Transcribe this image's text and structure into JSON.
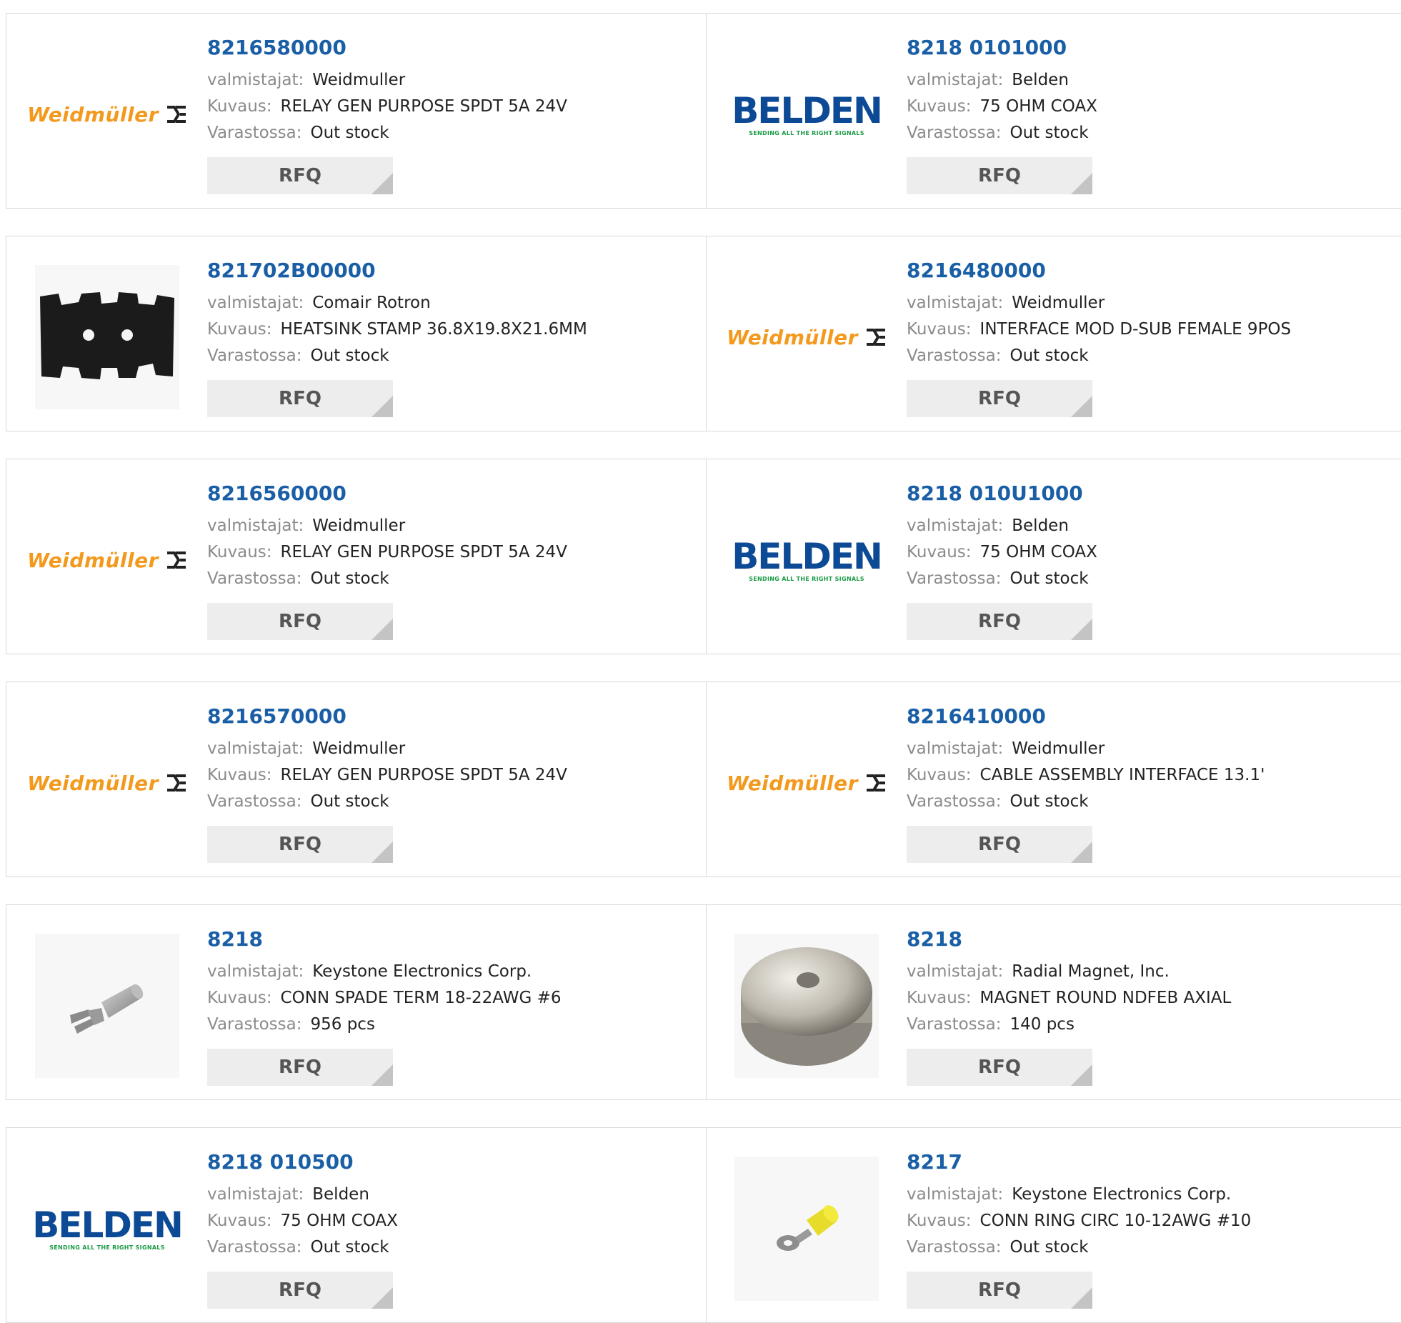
{
  "products": [
    {
      "part": "8216580000",
      "mfr_label": "valmistajat:",
      "mfr": "Weidmuller",
      "desc_label": "Kuvaus:",
      "desc": "RELAY GEN PURPOSE SPDT 5A 24V",
      "stock_label": "Varastossa:",
      "stock": "Out stock",
      "rfq": "RFQ",
      "thumb": "weidmuller-logo"
    },
    {
      "part": "8218 0101000",
      "mfr_label": "valmistajat:",
      "mfr": "Belden",
      "desc_label": "Kuvaus:",
      "desc": "75 OHM COAX",
      "stock_label": "Varastossa:",
      "stock": "Out stock",
      "rfq": "RFQ",
      "thumb": "belden-logo"
    },
    {
      "part": "821702B00000",
      "mfr_label": "valmistajat:",
      "mfr": "Comair Rotron",
      "desc_label": "Kuvaus:",
      "desc": "HEATSINK STAMP 36.8X19.8X21.6MM",
      "stock_label": "Varastossa:",
      "stock": "Out stock",
      "rfq": "RFQ",
      "thumb": "heatsink-photo"
    },
    {
      "part": "8216480000",
      "mfr_label": "valmistajat:",
      "mfr": "Weidmuller",
      "desc_label": "Kuvaus:",
      "desc": "INTERFACE MOD D-SUB FEMALE 9POS",
      "stock_label": "Varastossa:",
      "stock": "Out stock",
      "rfq": "RFQ",
      "thumb": "weidmuller-logo"
    },
    {
      "part": "8216560000",
      "mfr_label": "valmistajat:",
      "mfr": "Weidmuller",
      "desc_label": "Kuvaus:",
      "desc": "RELAY GEN PURPOSE SPDT 5A 24V",
      "stock_label": "Varastossa:",
      "stock": "Out stock",
      "rfq": "RFQ",
      "thumb": "weidmuller-logo"
    },
    {
      "part": "8218 010U1000",
      "mfr_label": "valmistajat:",
      "mfr": "Belden",
      "desc_label": "Kuvaus:",
      "desc": "75 OHM COAX",
      "stock_label": "Varastossa:",
      "stock": "Out stock",
      "rfq": "RFQ",
      "thumb": "belden-logo"
    },
    {
      "part": "8216570000",
      "mfr_label": "valmistajat:",
      "mfr": "Weidmuller",
      "desc_label": "Kuvaus:",
      "desc": "RELAY GEN PURPOSE SPDT 5A 24V",
      "stock_label": "Varastossa:",
      "stock": "Out stock",
      "rfq": "RFQ",
      "thumb": "weidmuller-logo"
    },
    {
      "part": "8216410000",
      "mfr_label": "valmistajat:",
      "mfr": "Weidmuller",
      "desc_label": "Kuvaus:",
      "desc": "CABLE ASSEMBLY INTERFACE 13.1'",
      "stock_label": "Varastossa:",
      "stock": "Out stock",
      "rfq": "RFQ",
      "thumb": "weidmuller-logo"
    },
    {
      "part": "8218",
      "mfr_label": "valmistajat:",
      "mfr": "Keystone Electronics Corp.",
      "desc_label": "Kuvaus:",
      "desc": "CONN SPADE TERM 18-22AWG #6",
      "stock_label": "Varastossa:",
      "stock": "956 pcs",
      "rfq": "RFQ",
      "thumb": "spade-terminal-photo"
    },
    {
      "part": "8218",
      "mfr_label": "valmistajat:",
      "mfr": "Radial Magnet, Inc.",
      "desc_label": "Kuvaus:",
      "desc": "MAGNET ROUND NDFEB AXIAL",
      "stock_label": "Varastossa:",
      "stock": "140 pcs",
      "rfq": "RFQ",
      "thumb": "magnet-photo"
    },
    {
      "part": "8218 010500",
      "mfr_label": "valmistajat:",
      "mfr": "Belden",
      "desc_label": "Kuvaus:",
      "desc": "75 OHM COAX",
      "stock_label": "Varastossa:",
      "stock": "Out stock",
      "rfq": "RFQ",
      "thumb": "belden-logo"
    },
    {
      "part": "8217",
      "mfr_label": "valmistajat:",
      "mfr": "Keystone Electronics Corp.",
      "desc_label": "Kuvaus:",
      "desc": "CONN RING CIRC 10-12AWG #10",
      "stock_label": "Varastossa:",
      "stock": "Out stock",
      "rfq": "RFQ",
      "thumb": "ring-terminal-photo"
    }
  ],
  "logos": {
    "weidmuller": "Weidmüller",
    "belden_name": "BELDEN",
    "belden_tag": "SENDING ALL THE RIGHT SIGNALS"
  },
  "colors": {
    "part_link": "#1a5fa6",
    "label": "#8b8b8b",
    "weidmuller": "#f39a1e",
    "belden": "#0d4a96",
    "belden_tag": "#1a9a45"
  }
}
